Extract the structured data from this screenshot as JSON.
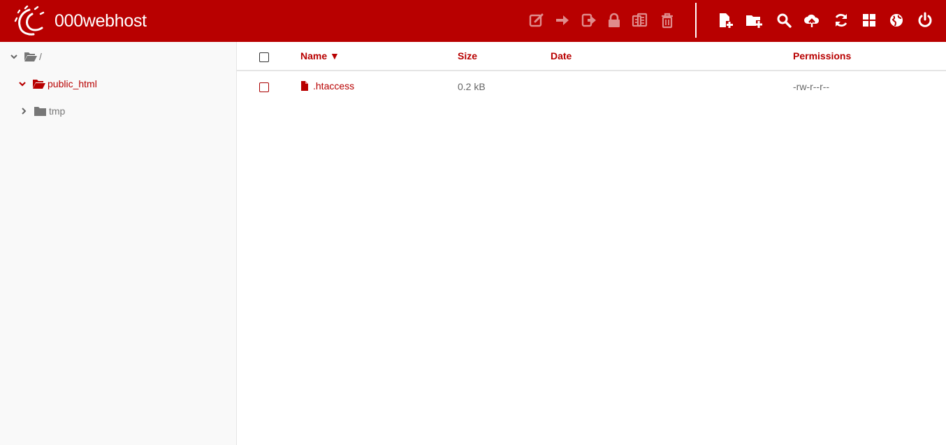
{
  "brand": {
    "name": "000webhost"
  },
  "colors": {
    "accent": "#b80000",
    "toolbar_icon": "#ffffff"
  },
  "toolbar": {
    "selection_tools": [
      {
        "name": "edit-icon"
      },
      {
        "name": "move-icon"
      },
      {
        "name": "copy-icon"
      },
      {
        "name": "lock-icon"
      },
      {
        "name": "archive-icon"
      },
      {
        "name": "trash-icon"
      }
    ],
    "global_tools": [
      {
        "name": "new-file-icon"
      },
      {
        "name": "new-folder-icon"
      },
      {
        "name": "search-icon"
      },
      {
        "name": "upload-icon"
      },
      {
        "name": "refresh-icon"
      },
      {
        "name": "grid-view-icon"
      },
      {
        "name": "globe-icon"
      },
      {
        "name": "power-icon"
      }
    ]
  },
  "tree": {
    "root": {
      "label": "/"
    },
    "items": [
      {
        "label": "public_html",
        "expanded": true,
        "active": true
      },
      {
        "label": "tmp",
        "expanded": false,
        "active": false
      }
    ]
  },
  "table": {
    "headers": {
      "name": "Name ▼",
      "size": "Size",
      "date": "Date",
      "permissions": "Permissions"
    },
    "rows": [
      {
        "name": ".htaccess",
        "size": "0.2 kB",
        "date": "",
        "permissions": "-rw-r--r--"
      }
    ]
  }
}
